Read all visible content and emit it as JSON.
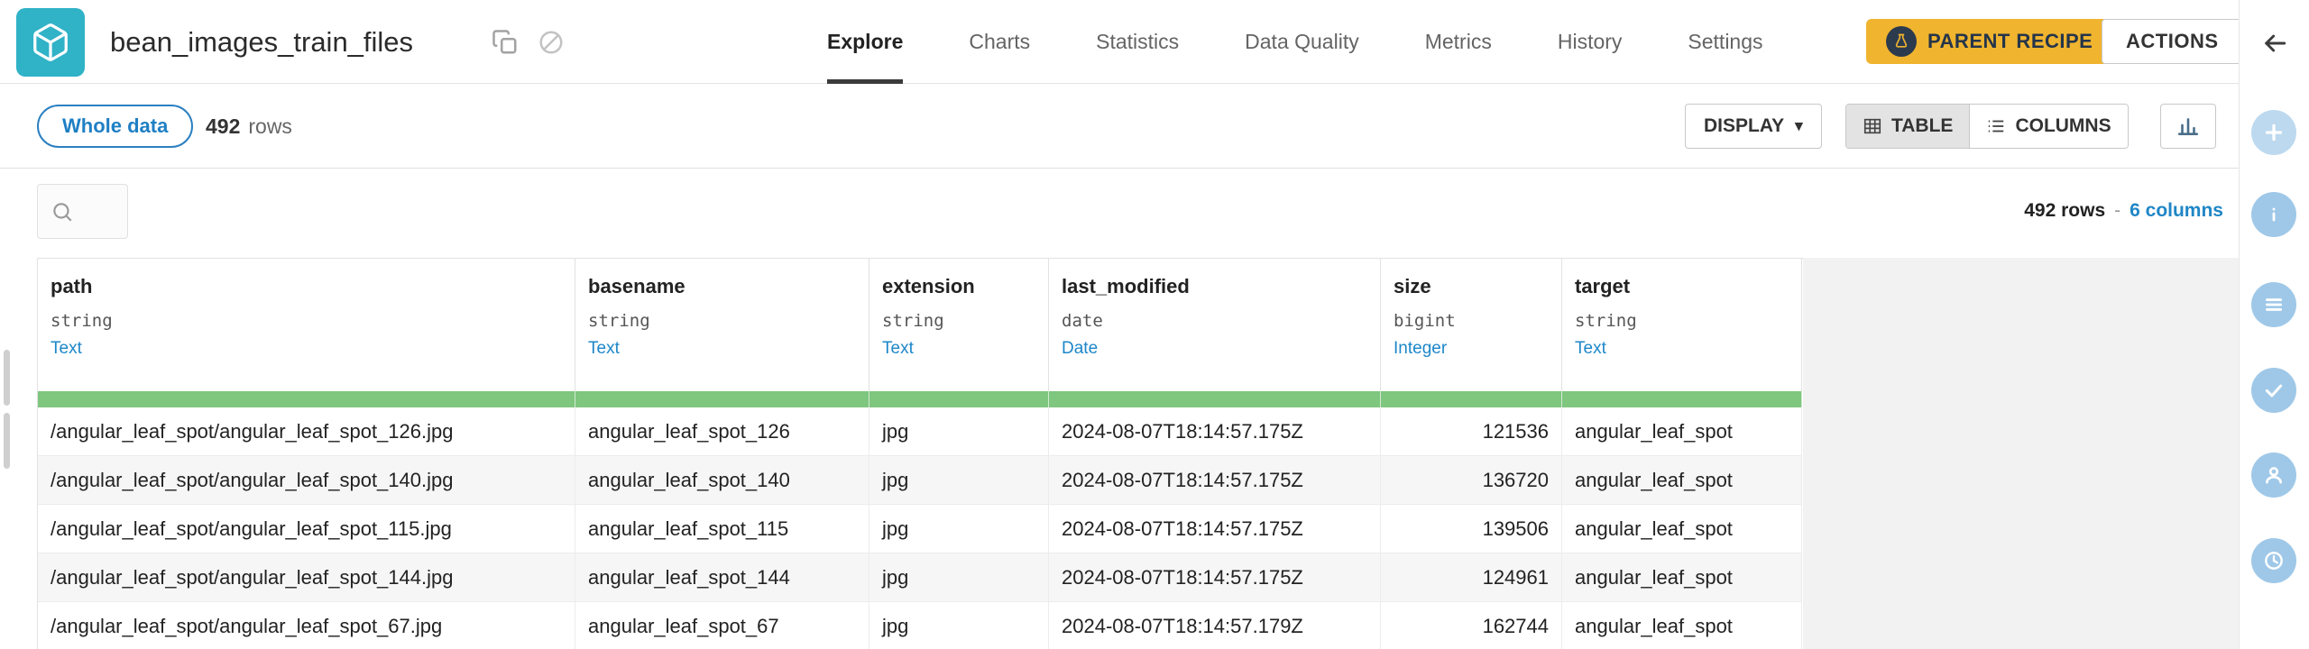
{
  "header": {
    "title": "bean_images_train_files",
    "tabs": [
      {
        "label": "Explore",
        "active": true
      },
      {
        "label": "Charts",
        "active": false
      },
      {
        "label": "Statistics",
        "active": false
      },
      {
        "label": "Data Quality",
        "active": false
      },
      {
        "label": "Metrics",
        "active": false
      },
      {
        "label": "History",
        "active": false
      },
      {
        "label": "Settings",
        "active": false
      }
    ],
    "parent_recipe_label": "PARENT RECIPE",
    "actions_label": "ACTIONS"
  },
  "toolbar": {
    "sample_button": "Whole data",
    "row_count": "492",
    "row_count_word": "rows",
    "display_button": "DISPLAY",
    "display_caret": "▾",
    "table_button": "TABLE",
    "columns_button": "COLUMNS"
  },
  "table_summary": {
    "rows": "492 rows",
    "separator": "-",
    "columns_link": "6 columns"
  },
  "table": {
    "columns": [
      {
        "name": "path",
        "type": "string",
        "meaning": "Text"
      },
      {
        "name": "basename",
        "type": "string",
        "meaning": "Text"
      },
      {
        "name": "extension",
        "type": "string",
        "meaning": "Text"
      },
      {
        "name": "last_modified",
        "type": "date",
        "meaning": "Date"
      },
      {
        "name": "size",
        "type": "bigint",
        "meaning": "Integer"
      },
      {
        "name": "target",
        "type": "string",
        "meaning": "Text"
      }
    ],
    "rows": [
      [
        "/angular_leaf_spot/angular_leaf_spot_126.jpg",
        "angular_leaf_spot_126",
        "jpg",
        "2024-08-07T18:14:57.175Z",
        "121536",
        "angular_leaf_spot"
      ],
      [
        "/angular_leaf_spot/angular_leaf_spot_140.jpg",
        "angular_leaf_spot_140",
        "jpg",
        "2024-08-07T18:14:57.175Z",
        "136720",
        "angular_leaf_spot"
      ],
      [
        "/angular_leaf_spot/angular_leaf_spot_115.jpg",
        "angular_leaf_spot_115",
        "jpg",
        "2024-08-07T18:14:57.175Z",
        "139506",
        "angular_leaf_spot"
      ],
      [
        "/angular_leaf_spot/angular_leaf_spot_144.jpg",
        "angular_leaf_spot_144",
        "jpg",
        "2024-08-07T18:14:57.175Z",
        "124961",
        "angular_leaf_spot"
      ],
      [
        "/angular_leaf_spot/angular_leaf_spot_67.jpg",
        "angular_leaf_spot_67",
        "jpg",
        "2024-08-07T18:14:57.179Z",
        "162744",
        "angular_leaf_spot"
      ]
    ]
  },
  "colors": {
    "brand_teal": "#30b2c7",
    "link_blue": "#1f86c6",
    "validity_green": "#7fc67f",
    "parent_recipe_yellow": "#f0b42f",
    "active_tab_underline": "#3b3b3b"
  }
}
